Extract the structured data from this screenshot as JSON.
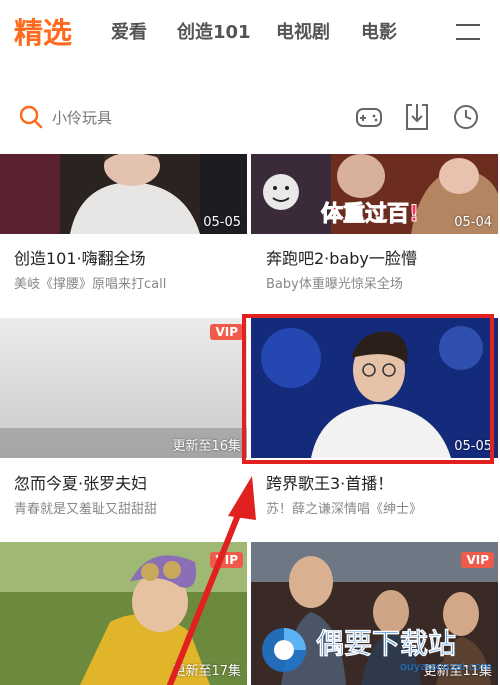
{
  "nav": {
    "tabs": [
      "精选",
      "爱看",
      "创造101",
      "电视剧",
      "电影"
    ]
  },
  "search": {
    "placeholder": "小伶玩具"
  },
  "cards": [
    {
      "title": "创造101·嗨翻全场",
      "subtitle": "美岐《撑腰》原唱来打call",
      "date": "05-05"
    },
    {
      "title": "奔跑吧2·baby一脸懵",
      "subtitle": "Baby体重曝光惊呆全场",
      "date": "05-04",
      "overlay_text": "体重过百!"
    },
    {
      "title": "忽而今夏·张罗夫妇",
      "subtitle": "青春就是又羞耻又甜甜甜",
      "update": "更新至16集",
      "badge": "VIP"
    },
    {
      "title": "跨界歌王3·首播！",
      "subtitle": "苏！薛之谦深情唱《绅士》",
      "date": "05-05"
    },
    {
      "update": "更新至17集",
      "badge": "VIP"
    },
    {
      "update": "更新至11集",
      "badge": "VIP"
    }
  ],
  "watermark": {
    "name": "偶要下载站",
    "url": "ouyaoxiazai.com"
  },
  "colors": {
    "accent": "#ff6a1e",
    "highlight": "#e0211f",
    "vip": "#f05a4a"
  }
}
